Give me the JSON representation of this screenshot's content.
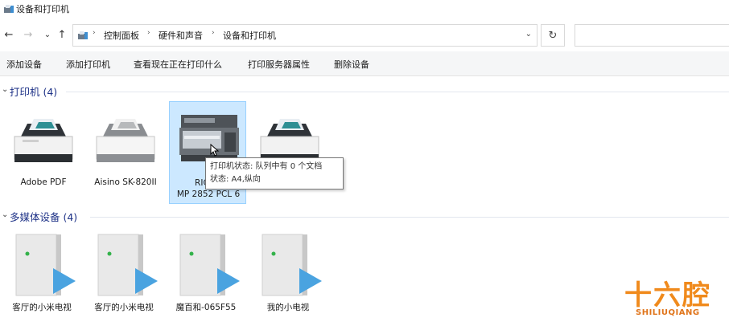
{
  "window": {
    "title": "设备和打印机"
  },
  "nav": {
    "back_icon": "←",
    "forward_icon": "→",
    "recent_icon": "⌄",
    "up_icon": "↑",
    "breadcrumb": [
      "控制面板",
      "硬件和声音",
      "设备和打印机"
    ],
    "crumb_separator": "›",
    "dropdown_icon": "⌄",
    "refresh_icon": "↻",
    "search_placeholder": ""
  },
  "commands": [
    "添加设备",
    "添加打印机",
    "查看现在正在打印什么",
    "打印服务器属性",
    "删除设备"
  ],
  "groups": {
    "printers": {
      "title": "打印机 (4)",
      "items": [
        {
          "label_line1": "Adobe PDF",
          "label_line2": ""
        },
        {
          "label_line1": "Aisino SK-820II",
          "label_line2": ""
        },
        {
          "label_line1": "RICOH",
          "label_line2": "MP 2852 PCL 6"
        },
        {
          "label_line1": "",
          "label_line2": ""
        }
      ]
    },
    "media": {
      "title": "多媒体设备 (4)",
      "items": [
        {
          "label": "客厅的小米电视"
        },
        {
          "label": "客厅的小米电视"
        },
        {
          "label": "魔百和-065F55"
        },
        {
          "label": "我的小电视"
        }
      ]
    }
  },
  "tooltip": {
    "line1": "打印机状态: 队列中有 0 个文档",
    "line2": "状态: A4,纵向"
  },
  "watermark": {
    "main": "十六腔",
    "sub": "SHILIUQIANG"
  },
  "colors": {
    "group_title": "#1e3287",
    "selection_bg": "#cce8ff",
    "watermark": "#f08a1c"
  }
}
